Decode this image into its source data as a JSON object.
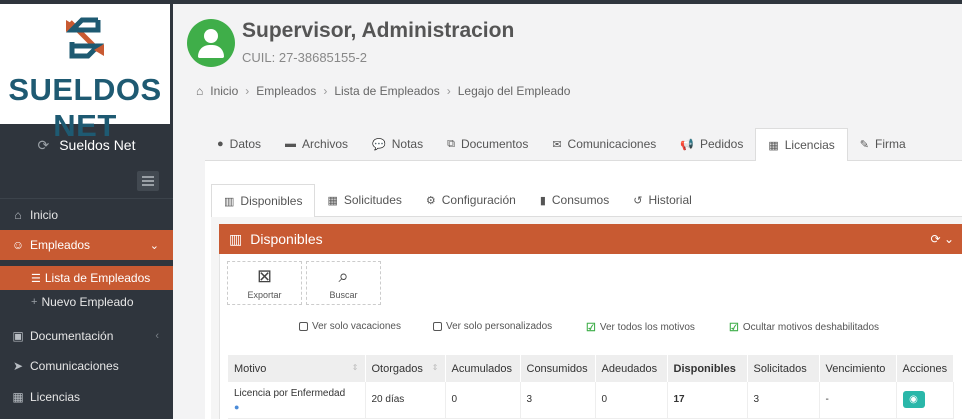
{
  "brand": {
    "logo_text": "SUELDOS NET",
    "app_name": "Sueldos Net",
    "colors": {
      "accent": "#c85a32",
      "sidebar": "#2f353d",
      "logo_blue": "#1e5a72",
      "avatar": "#3fae49",
      "action": "#2ab7a9"
    }
  },
  "sidebar": {
    "items": [
      {
        "label": "Inicio",
        "icon": "home-icon"
      },
      {
        "label": "Empleados",
        "icon": "users-icon"
      },
      {
        "label": "Documentación",
        "icon": "folder-icon"
      },
      {
        "label": "Comunicaciones",
        "icon": "send-icon"
      },
      {
        "label": "Licencias",
        "icon": "calendar-icon"
      }
    ],
    "sub_items": [
      {
        "label": "Lista de Empleados",
        "icon": "list-icon"
      },
      {
        "label": "Nuevo Empleado",
        "icon": "plus-icon"
      }
    ]
  },
  "employee": {
    "name": "Supervisor, Administracion",
    "cuil": "CUIL: 27-38685155-2"
  },
  "breadcrumb": [
    "Inicio",
    "Empleados",
    "Lista de Empleados",
    "Legajo del Empleado"
  ],
  "tabs": [
    {
      "label": "Datos",
      "icon": "user-icon"
    },
    {
      "label": "Archivos",
      "icon": "archive-icon"
    },
    {
      "label": "Notas",
      "icon": "comments-icon"
    },
    {
      "label": "Documentos",
      "icon": "copy-icon"
    },
    {
      "label": "Comunicaciones",
      "icon": "envelope-icon"
    },
    {
      "label": "Pedidos",
      "icon": "bullhorn-icon"
    },
    {
      "label": "Licencias",
      "icon": "calendar-icon"
    },
    {
      "label": "Firma",
      "icon": "edit-icon"
    }
  ],
  "sub_tabs": [
    {
      "label": "Disponibles",
      "icon": "bar-chart-icon"
    },
    {
      "label": "Solicitudes",
      "icon": "calendar-icon"
    },
    {
      "label": "Configuración",
      "icon": "gear-icon"
    },
    {
      "label": "Consumos",
      "icon": "book-icon"
    },
    {
      "label": "Historial",
      "icon": "history-icon"
    }
  ],
  "panel": {
    "title": "Disponibles",
    "toolbar": {
      "export_label": "Exportar",
      "search_label": "Buscar"
    },
    "filters": [
      {
        "label": "Ver solo vacaciones",
        "checked": false
      },
      {
        "label": "Ver solo personalizados",
        "checked": false
      },
      {
        "label": "Ver todos los motivos",
        "checked": true
      },
      {
        "label": "Ocultar motivos deshabilitados",
        "checked": true
      }
    ]
  },
  "table": {
    "columns": [
      "Motivo",
      "Otorgados",
      "Acumulados",
      "Consumidos",
      "Adeudados",
      "Disponibles",
      "Solicitados",
      "Vencimiento",
      "Acciones"
    ],
    "rows": [
      {
        "motivo": "Licencia por Enfermedad",
        "otorgados": "20 días",
        "acumulados": "0",
        "consumidos": "3",
        "adeudados": "0",
        "disponibles": "17",
        "solicitados": "3",
        "vencimiento": "-"
      }
    ]
  }
}
